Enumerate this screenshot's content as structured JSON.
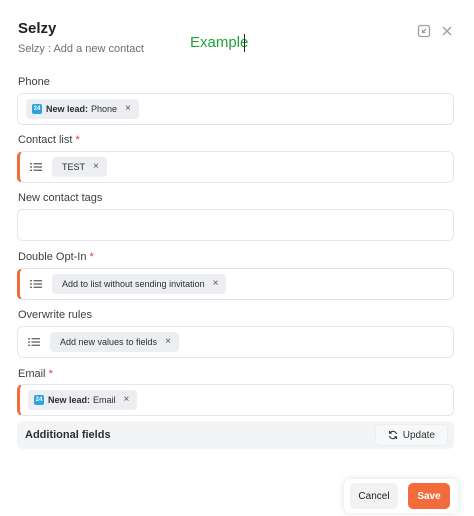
{
  "header": {
    "title": "Selzy",
    "subtitle": "Selzy : Add a new contact",
    "typed_text": "Example"
  },
  "icons": {
    "collapse": "collapse-icon",
    "close": "close-icon",
    "list": "list-icon",
    "refresh": "refresh-icon",
    "remove": "×"
  },
  "fields": {
    "phone": {
      "label": "Phone",
      "required": false,
      "chip": {
        "badge": "24",
        "bold": "New lead:",
        "text": "Phone"
      }
    },
    "contact_list": {
      "label": "Contact list",
      "required_mark": "*",
      "chip": {
        "text": "TEST"
      }
    },
    "new_contact_tags": {
      "label": "New contact tags"
    },
    "double_opt_in": {
      "label": "Double Opt-In",
      "required_mark": "*",
      "chip": {
        "text": "Add to list without sending invitation"
      }
    },
    "overwrite_rules": {
      "label": "Overwrite rules",
      "chip": {
        "text": "Add new values to fields"
      }
    },
    "email": {
      "label": "Email",
      "required_mark": "*",
      "chip": {
        "badge": "24",
        "bold": "New lead:",
        "text": "Email"
      }
    }
  },
  "additional_fields": {
    "label": "Additional fields",
    "update_label": "Update"
  },
  "footer": {
    "cancel_label": "Cancel",
    "save_label": "Save"
  },
  "colors": {
    "accent": "#f26b3a",
    "required_star": "#e53935",
    "typed_text": "#22a33a",
    "badge": "#2da3e0"
  }
}
